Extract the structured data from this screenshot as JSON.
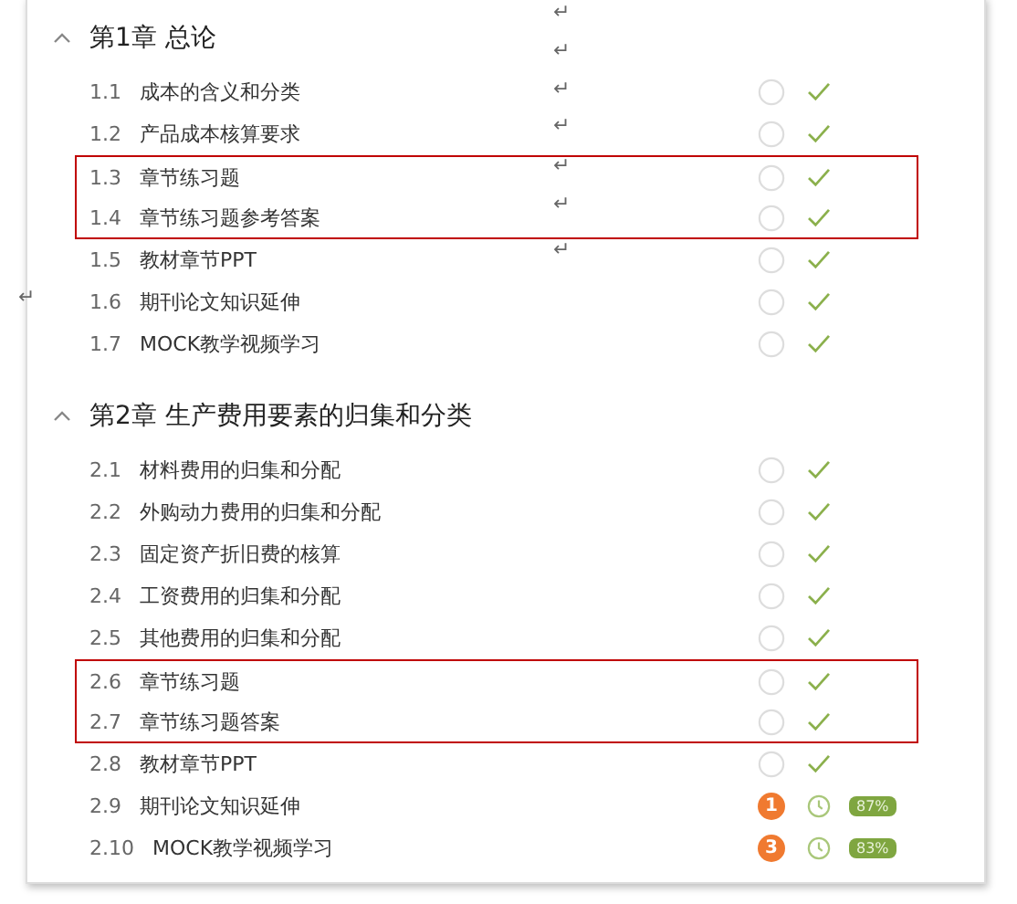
{
  "chapters": [
    {
      "title": "第1章 总论",
      "expanded": true,
      "items": [
        {
          "number": "1.1",
          "title": "成本的含义和分类",
          "kind": "done",
          "highlighted": false
        },
        {
          "number": "1.2",
          "title": "产品成本核算要求",
          "kind": "done",
          "highlighted": false
        },
        {
          "number": "1.3",
          "title": "章节练习题",
          "kind": "done",
          "highlighted": true
        },
        {
          "number": "1.4",
          "title": "章节练习题参考答案",
          "kind": "done",
          "highlighted": true
        },
        {
          "number": "1.5",
          "title": "教材章节PPT",
          "kind": "done",
          "highlighted": false
        },
        {
          "number": "1.6",
          "title": "期刊论文知识延伸",
          "kind": "done",
          "highlighted": false
        },
        {
          "number": "1.7",
          "title": "MOCK教学视频学习",
          "kind": "done",
          "highlighted": false
        }
      ]
    },
    {
      "title": "第2章 生产费用要素的归集和分类",
      "expanded": true,
      "items": [
        {
          "number": "2.1",
          "title": "材料费用的归集和分配",
          "kind": "done",
          "highlighted": false
        },
        {
          "number": "2.2",
          "title": "外购动力费用的归集和分配",
          "kind": "done",
          "highlighted": false
        },
        {
          "number": "2.3",
          "title": "固定资产折旧费的核算",
          "kind": "done",
          "highlighted": false
        },
        {
          "number": "2.4",
          "title": "工资费用的归集和分配",
          "kind": "done",
          "highlighted": false
        },
        {
          "number": "2.5",
          "title": "其他费用的归集和分配",
          "kind": "done",
          "highlighted": false
        },
        {
          "number": "2.6",
          "title": "章节练习题",
          "kind": "done",
          "highlighted": true
        },
        {
          "number": "2.7",
          "title": "章节练习题答案",
          "kind": "done",
          "highlighted": true
        },
        {
          "number": "2.8",
          "title": "教材章节PPT",
          "kind": "done",
          "highlighted": false
        },
        {
          "number": "2.9",
          "title": "期刊论文知识延伸",
          "kind": "progress",
          "count": "1",
          "percent": "87%",
          "highlighted": false
        },
        {
          "number": "2.10",
          "title": "MOCK教学视频学习",
          "kind": "progress",
          "count": "3",
          "percent": "83%",
          "highlighted": false
        }
      ]
    }
  ],
  "paragraph_marks": [
    "↵",
    "↵",
    "↵",
    "↵",
    "↵",
    "↵",
    "↵",
    "↵"
  ]
}
